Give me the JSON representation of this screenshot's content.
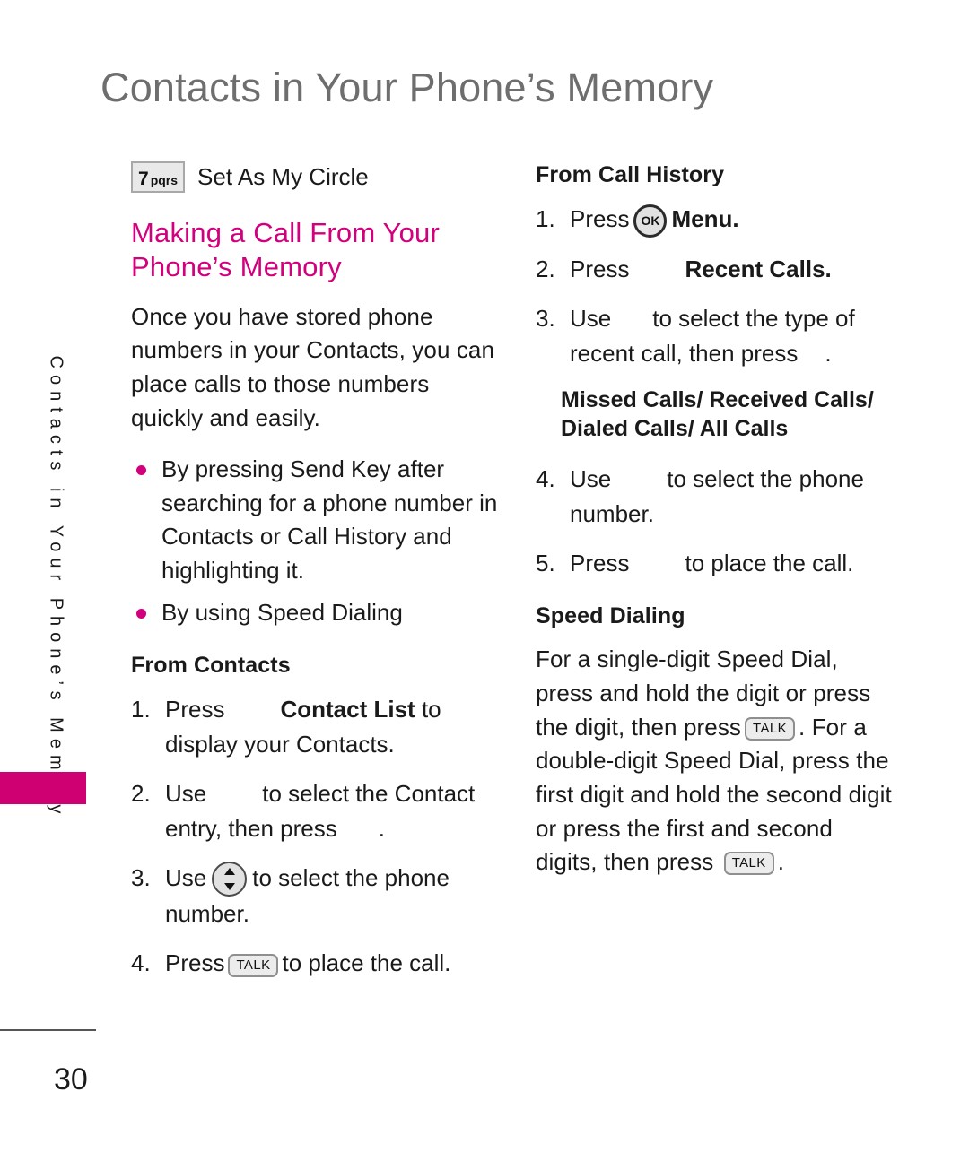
{
  "page": {
    "title": "Contacts in Your Phone’s Memory",
    "side_tab_text": "Contacts in Your Phone’s Memory",
    "number": "30",
    "accent_color": "#d3007d",
    "tab_color": "#cf0072",
    "title_color": "#6e6e6e"
  },
  "icons": {
    "key7_digit": "7",
    "key7_letters": "pqrs",
    "talk_label": "TALK",
    "ok_label": "OK"
  },
  "left": {
    "set_as_my_circle": "Set As My Circle",
    "heading_pink": "Making a Call From Your Phone’s Memory",
    "intro": "Once you have stored phone numbers in your Contacts, you can place calls to those numbers quickly and easily.",
    "bullets": [
      "By pressing Send Key after searching for a phone number in Contacts or Call History and highlighting it.",
      "By using Speed Dialing"
    ],
    "from_contacts_heading": "From Contacts",
    "steps": [
      {
        "num": "1.",
        "pre": "Press",
        "bold": "Contact List",
        "post": "to display your Contacts."
      },
      {
        "num": "2.",
        "pre": "Use",
        "bold": "",
        "post": "to select the Contact entry, then press"
      },
      {
        "num": "3.",
        "pre": "Use",
        "bold": "",
        "post": "to select the phone number."
      },
      {
        "num": "4.",
        "pre": "Press",
        "bold": "",
        "post": "to place the call."
      }
    ]
  },
  "right": {
    "from_call_history_heading": "From Call History",
    "steps": [
      {
        "num": "1.",
        "pre": "Press",
        "bold": "Menu.",
        "post": ""
      },
      {
        "num": "2.",
        "pre": "Press",
        "bold": "Recent Calls.",
        "post": ""
      },
      {
        "num": "3.",
        "pre": "Use",
        "bold": "",
        "post": "to select the type of recent call, then press"
      },
      {
        "num": "4.",
        "pre": "Use",
        "bold": "",
        "post": "to select the phone number."
      },
      {
        "num": "5.",
        "pre": "Press",
        "bold": "",
        "post": "to place the call."
      }
    ],
    "call_types": "Missed Calls/ Received Calls/ Dialed Calls/ All Calls",
    "speed_dialing_heading": "Speed Dialing",
    "speed_dialing_part1": "For a single-digit Speed Dial, press and hold the digit or press the digit, then press",
    "speed_dialing_part2": ". For a double-digit Speed Dial, press the first digit and hold the second digit or press the first and second digits, then press",
    "speed_dialing_part3": "."
  }
}
